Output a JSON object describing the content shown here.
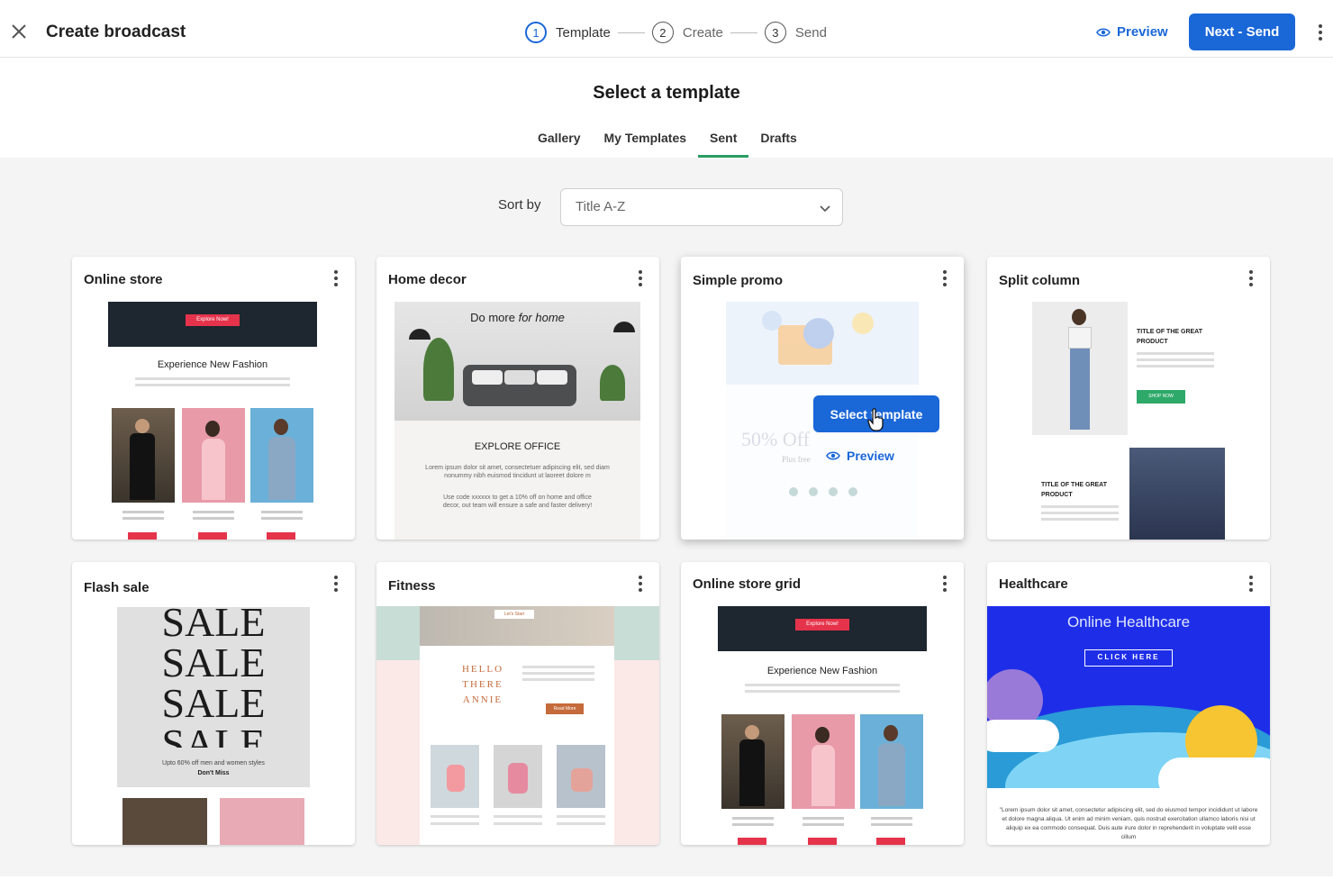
{
  "header": {
    "title": "Create broadcast",
    "preview_label": "Preview",
    "next_label": "Next - Send"
  },
  "steps": [
    {
      "num": "1",
      "label": "Template"
    },
    {
      "num": "2",
      "label": "Create"
    },
    {
      "num": "3",
      "label": "Send"
    }
  ],
  "main": {
    "title": "Select a template"
  },
  "tabs": [
    {
      "label": "Gallery"
    },
    {
      "label": "My Templates"
    },
    {
      "label": "Sent"
    },
    {
      "label": "Drafts"
    }
  ],
  "sort": {
    "label": "Sort by",
    "value": "Title A-Z"
  },
  "cards": [
    {
      "title": "Online store",
      "hero_button": "Explore Now!",
      "heading": "Experience New Fashion"
    },
    {
      "title": "Home decor",
      "hero_text": "Do more",
      "hero_italic": "for home",
      "heading": "EXPLORE OFFICE",
      "body": "Lorem ipsum dolor sit amet, consectetuer adipiscing elit, sed diam nonummy nibh euismod tincidunt ut laoreet dolore m",
      "body2": "Use code xxxxxx to get a 10% off on home and office decor, out team will ensure a safe and faster delivery!"
    },
    {
      "title": "Simple promo",
      "select_label": "Select template",
      "preview_label": "Preview",
      "promo_text": "50% Off",
      "promo_sub": "Plus free"
    },
    {
      "title": "Split column",
      "heading1": "TITLE OF THE GREAT PRODUCT",
      "btn": "SHOP NOW",
      "heading2": "TITLE OF THE GREAT PRODUCT"
    },
    {
      "title": "Flash sale",
      "sale_word": "SALE",
      "caption": "Upto 60% off men and women styles",
      "caption2": "Don't Miss"
    },
    {
      "title": "Fitness",
      "tag": "Let's Start",
      "greeting": "HELLO THERE ANNIE",
      "btn": "Read More"
    },
    {
      "title": "Online store grid",
      "hero_button": "Explore Now!",
      "heading": "Experience New Fashion"
    },
    {
      "title": "Healthcare",
      "hero_title": "Online Healthcare",
      "btn": "CLICK HERE",
      "body": "\"Lorem ipsum dolor sit amet, consectetur adipiscing elit, sed do eiusmod tempor incididunt ut labore et dolore magna aliqua. Ut enim ad minim veniam, quis nostrud exercitation ullamco laboris nisi ut aliquip ex ea commodo consequat. Duis aute irure dolor in reprehenderit in voluptate velit esse cillum"
    }
  ],
  "colors": {
    "primary": "#1a67d8",
    "tab_underline": "#2a9d63",
    "promo_red": "#e5334b",
    "health_blue": "#1e2ee8"
  }
}
